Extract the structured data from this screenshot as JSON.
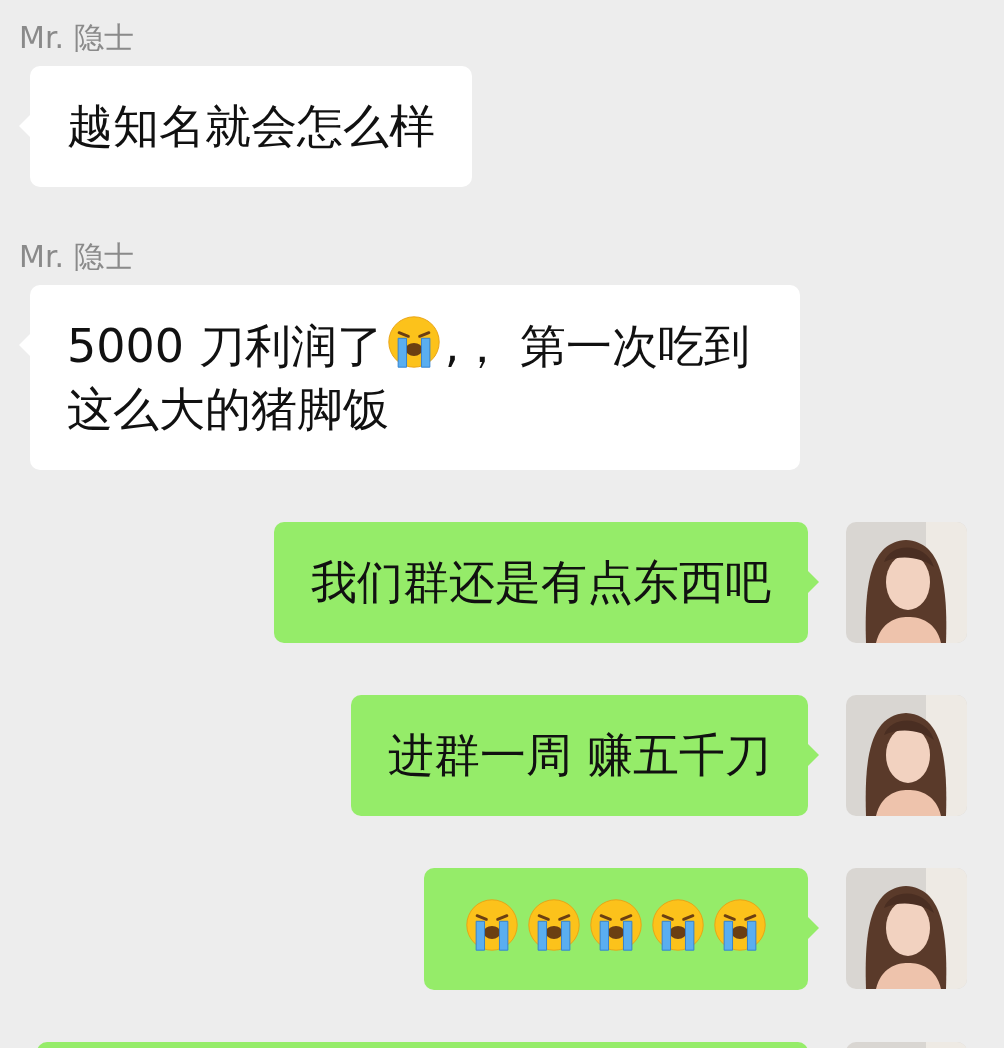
{
  "messages": [
    {
      "kind": "incoming",
      "sender": "Mr. 隐士",
      "parts": [
        {
          "kind": "text",
          "text": "越知名就会怎么样"
        }
      ]
    },
    {
      "kind": "incoming",
      "sender": "Mr. 隐士",
      "parts": [
        {
          "kind": "text",
          "text": "5000 刀利润了"
        },
        {
          "kind": "emoji"
        },
        {
          "kind": "text",
          "text": ",， 第一次吃到这么大的猪脚饭"
        }
      ]
    },
    {
      "kind": "outgoing",
      "parts": [
        {
          "kind": "text",
          "text": "我们群还是有点东西吧"
        }
      ]
    },
    {
      "kind": "outgoing",
      "parts": [
        {
          "kind": "text",
          "text": "进群一周 赚五千刀"
        }
      ]
    },
    {
      "kind": "outgoing",
      "parts": [
        {
          "kind": "emoji"
        },
        {
          "kind": "emoji"
        },
        {
          "kind": "emoji"
        },
        {
          "kind": "emoji"
        },
        {
          "kind": "emoji"
        }
      ]
    },
    {
      "kind": "outgoing"
    }
  ]
}
